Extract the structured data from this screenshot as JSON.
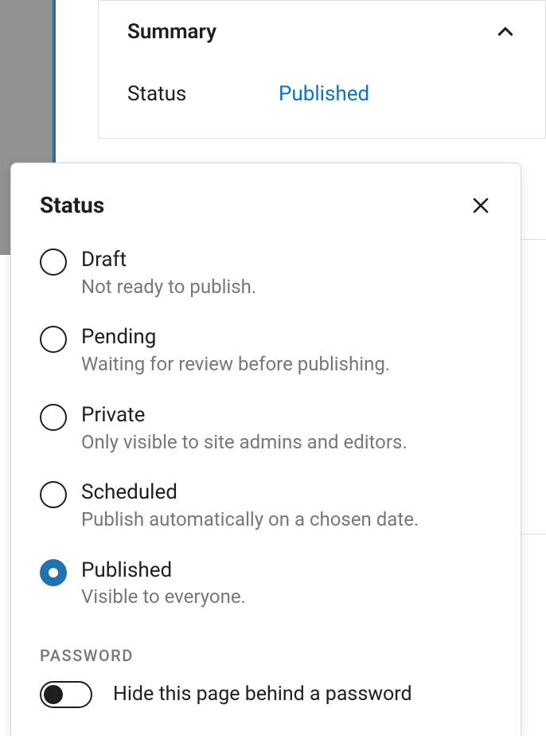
{
  "summary": {
    "title": "Summary",
    "status_label": "Status",
    "status_value": "Published"
  },
  "popover": {
    "title": "Status",
    "options": [
      {
        "label": "Draft",
        "desc": "Not ready to publish.",
        "selected": false
      },
      {
        "label": "Pending",
        "desc": "Waiting for review before publishing.",
        "selected": false
      },
      {
        "label": "Private",
        "desc": "Only visible to site admins and editors.",
        "selected": false
      },
      {
        "label": "Scheduled",
        "desc": "Publish automatically on a chosen date.",
        "selected": false
      },
      {
        "label": "Published",
        "desc": "Visible to everyone.",
        "selected": true
      }
    ],
    "password_heading": "Password",
    "password_toggle_label": "Hide this page behind a password",
    "password_toggle_on": false
  }
}
